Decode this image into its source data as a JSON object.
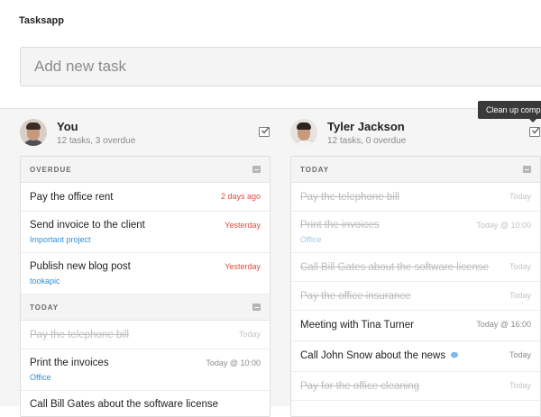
{
  "app": {
    "title": "Tasksapp"
  },
  "new_task": {
    "placeholder": "Add new task"
  },
  "tooltip": {
    "text": "Clean up comp"
  },
  "columns": [
    {
      "name": "You",
      "meta": "12 tasks, 3 overdue",
      "sections": [
        {
          "label": "OVERDUE",
          "tasks": [
            {
              "title": "Pay the office rent",
              "due": "2 days ago",
              "tag": "",
              "done": false
            },
            {
              "title": "Send invoice to the client",
              "due": "Yesterday",
              "tag": "Important project",
              "done": false
            },
            {
              "title": "Publish new blog post",
              "due": "Yesterday",
              "tag": "tookapic",
              "done": false
            }
          ]
        },
        {
          "label": "TODAY",
          "tasks": [
            {
              "title": "Pay the telephone bill",
              "due": "Today",
              "tag": "",
              "done": true
            },
            {
              "title": "Print the invoices",
              "due": "Today @ 10:00",
              "tag": "Office",
              "done": false
            },
            {
              "title": "Call Bill Gates about the software license",
              "due": "",
              "tag": "",
              "done": false
            }
          ]
        }
      ]
    },
    {
      "name": "Tyler Jackson",
      "meta": "12 tasks, 0 overdue",
      "sections": [
        {
          "label": "TODAY",
          "tasks": [
            {
              "title": "Pay the telephone bill",
              "due": "Today",
              "tag": "",
              "done": true
            },
            {
              "title": "Print the invoices",
              "due": "Today @ 10:00",
              "tag": "Office",
              "done": true
            },
            {
              "title": "Call Bill Gates about the software license",
              "due": "Today",
              "tag": "",
              "done": true
            },
            {
              "title": "Pay the office insurance",
              "due": "Today",
              "tag": "",
              "done": true
            },
            {
              "title": "Meeting with Tina Turner",
              "due": "Today @ 16:00",
              "tag": "",
              "done": false
            },
            {
              "title": "Call John Snow about the news",
              "due": "Today",
              "tag": "",
              "done": false,
              "has_comment": true
            },
            {
              "title": "Pay for the office cleaning",
              "due": "Today",
              "tag": "",
              "done": true
            }
          ]
        }
      ]
    }
  ],
  "icons": {
    "check": "checkbox-icon",
    "collapse": "collapse-icon",
    "comment": "comment-icon"
  },
  "colors": {
    "overdue": "#e24b3b",
    "tag": "#2f8fd9",
    "done_text": "#bdbdbd"
  }
}
